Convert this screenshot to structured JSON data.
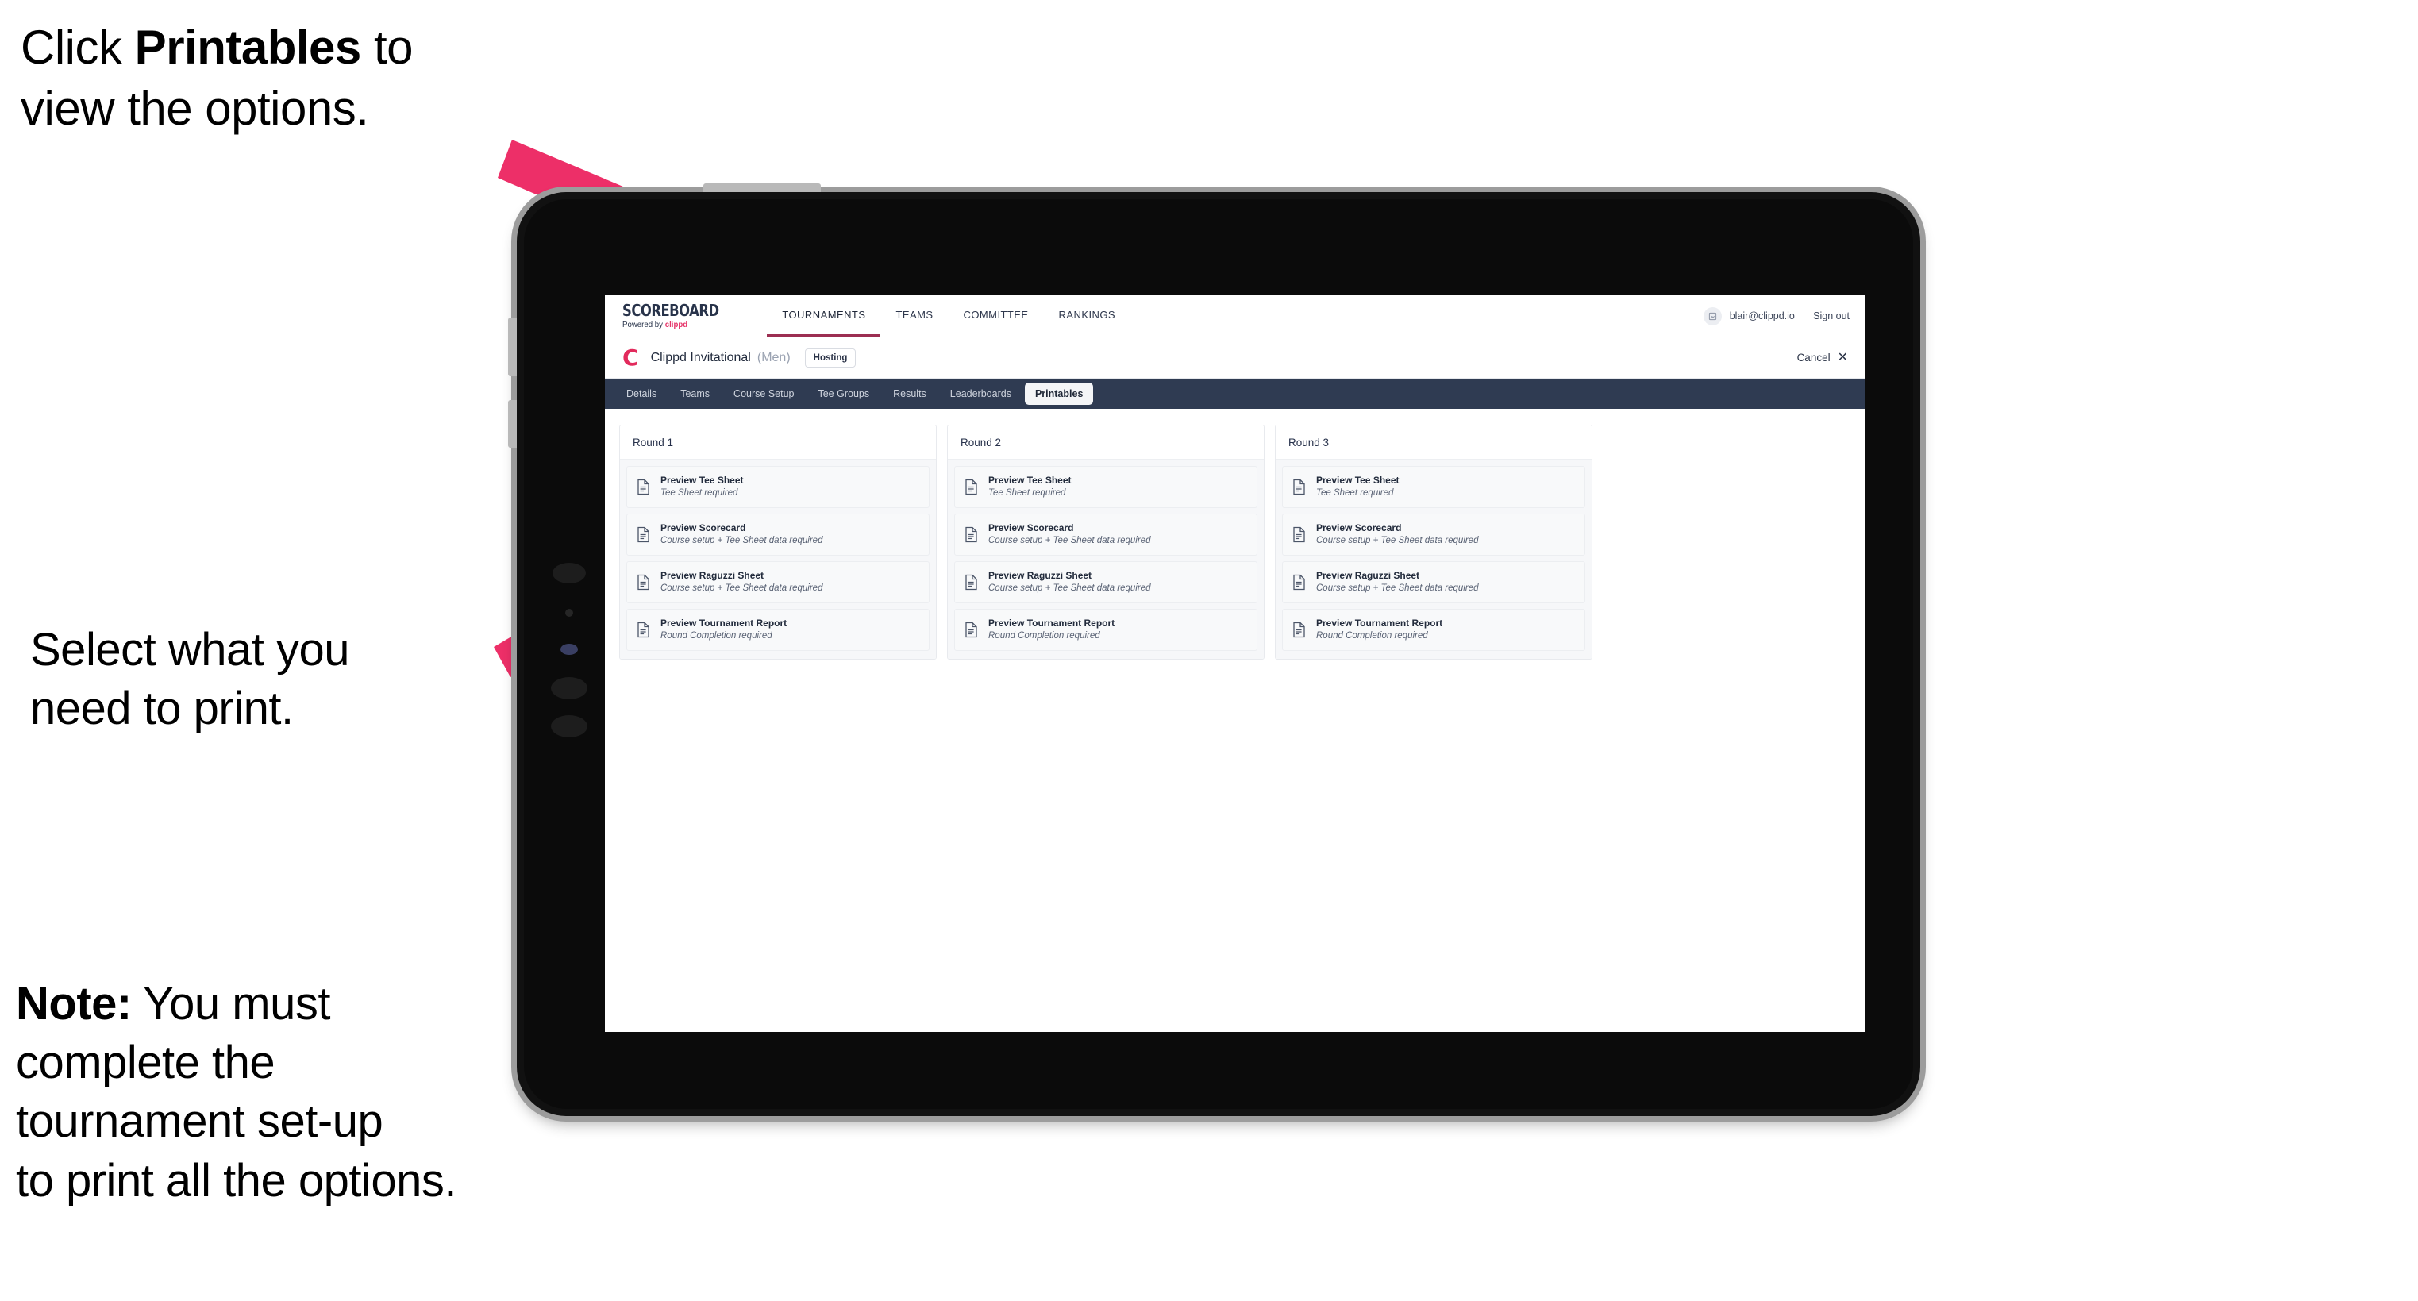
{
  "annotations": {
    "click_printables": {
      "lead": "Click ",
      "strong": "Printables",
      "tail": " to\nview the options."
    },
    "select_print": "Select what you\n  need to print.",
    "note": {
      "strong": "Note:",
      "body": " You must\ncomplete the\ntournament set-up\nto print all the options."
    }
  },
  "colors": {
    "arrow_pink": "#ed2f68",
    "brand_pink": "#e6356a",
    "tabbar_navy": "#2f3b52",
    "nav_active_underline": "#9c2f52",
    "device_body": "#111111",
    "device_bezel": "#9c9c9c"
  },
  "app": {
    "brand": {
      "title": "SCOREBOARD",
      "powered_by": "Powered by ",
      "powered_by_brand": "clippd"
    },
    "global_nav": [
      {
        "label": "TOURNAMENTS",
        "active": true
      },
      {
        "label": "TEAMS",
        "active": false
      },
      {
        "label": "COMMITTEE",
        "active": false
      },
      {
        "label": "RANKINGS",
        "active": false
      }
    ],
    "account": {
      "avatar_icon": "user-avatar-icon",
      "email": "blair@clippd.io",
      "separator": "|",
      "sign_out": "Sign out"
    },
    "tournament_bar": {
      "logo_letter": "C",
      "name": "Clippd Invitational",
      "gender": "(Men)",
      "status_badge": "Hosting",
      "cancel_label": "Cancel",
      "cancel_icon": "close-icon"
    },
    "tabs": [
      {
        "label": "Details",
        "active": false
      },
      {
        "label": "Teams",
        "active": false
      },
      {
        "label": "Course Setup",
        "active": false
      },
      {
        "label": "Tee Groups",
        "active": false
      },
      {
        "label": "Results",
        "active": false
      },
      {
        "label": "Leaderboards",
        "active": false
      },
      {
        "label": "Printables",
        "active": true
      }
    ],
    "rounds": [
      {
        "header": "Round 1",
        "items": [
          {
            "icon": "document-icon",
            "title": "Preview Tee Sheet",
            "subtitle": "Tee Sheet required"
          },
          {
            "icon": "document-icon",
            "title": "Preview Scorecard",
            "subtitle": "Course setup + Tee Sheet data required"
          },
          {
            "icon": "document-icon",
            "title": "Preview Raguzzi Sheet",
            "subtitle": "Course setup + Tee Sheet data required"
          },
          {
            "icon": "document-icon",
            "title": "Preview Tournament Report",
            "subtitle": "Round Completion required"
          }
        ]
      },
      {
        "header": "Round 2",
        "items": [
          {
            "icon": "document-icon",
            "title": "Preview Tee Sheet",
            "subtitle": "Tee Sheet required"
          },
          {
            "icon": "document-icon",
            "title": "Preview Scorecard",
            "subtitle": "Course setup + Tee Sheet data required"
          },
          {
            "icon": "document-icon",
            "title": "Preview Raguzzi Sheet",
            "subtitle": "Course setup + Tee Sheet data required"
          },
          {
            "icon": "document-icon",
            "title": "Preview Tournament Report",
            "subtitle": "Round Completion required"
          }
        ]
      },
      {
        "header": "Round 3",
        "items": [
          {
            "icon": "document-icon",
            "title": "Preview Tee Sheet",
            "subtitle": "Tee Sheet required"
          },
          {
            "icon": "document-icon",
            "title": "Preview Scorecard",
            "subtitle": "Course setup + Tee Sheet data required"
          },
          {
            "icon": "document-icon",
            "title": "Preview Raguzzi Sheet",
            "subtitle": "Course setup + Tee Sheet data required"
          },
          {
            "icon": "document-icon",
            "title": "Preview Tournament Report",
            "subtitle": "Round Completion required"
          }
        ]
      }
    ]
  }
}
